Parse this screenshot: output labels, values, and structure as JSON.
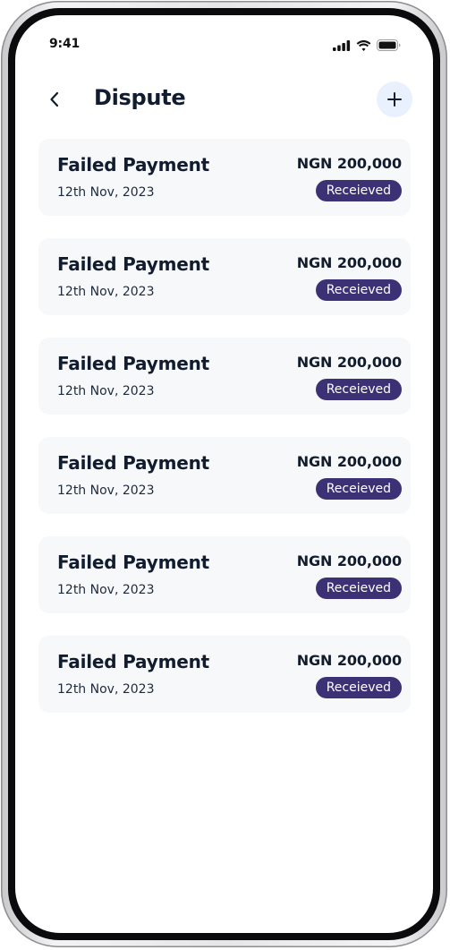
{
  "status_bar": {
    "time": "9:41"
  },
  "header": {
    "title": "Dispute",
    "back_icon": "chevron-left-icon",
    "add_icon": "plus-icon"
  },
  "disputes": [
    {
      "title": "Failed Payment",
      "date": "12th Nov, 2023",
      "amount": "NGN 200,000",
      "status": "Receieved"
    },
    {
      "title": "Failed Payment",
      "date": "12th Nov, 2023",
      "amount": "NGN 200,000",
      "status": "Receieved"
    },
    {
      "title": "Failed Payment",
      "date": "12th Nov, 2023",
      "amount": "NGN 200,000",
      "status": "Receieved"
    },
    {
      "title": "Failed Payment",
      "date": "12th Nov, 2023",
      "amount": "NGN 200,000",
      "status": "Receieved"
    },
    {
      "title": "Failed Payment",
      "date": "12th Nov, 2023",
      "amount": "NGN 200,000",
      "status": "Receieved"
    },
    {
      "title": "Failed Payment",
      "date": "12th Nov, 2023",
      "amount": "NGN 200,000",
      "status": "Receieved"
    }
  ],
  "colors": {
    "badge_background": "#3d3175",
    "card_background": "#f7f8fa",
    "add_button_background": "#e8f1fd",
    "text_primary": "#111c2e"
  }
}
